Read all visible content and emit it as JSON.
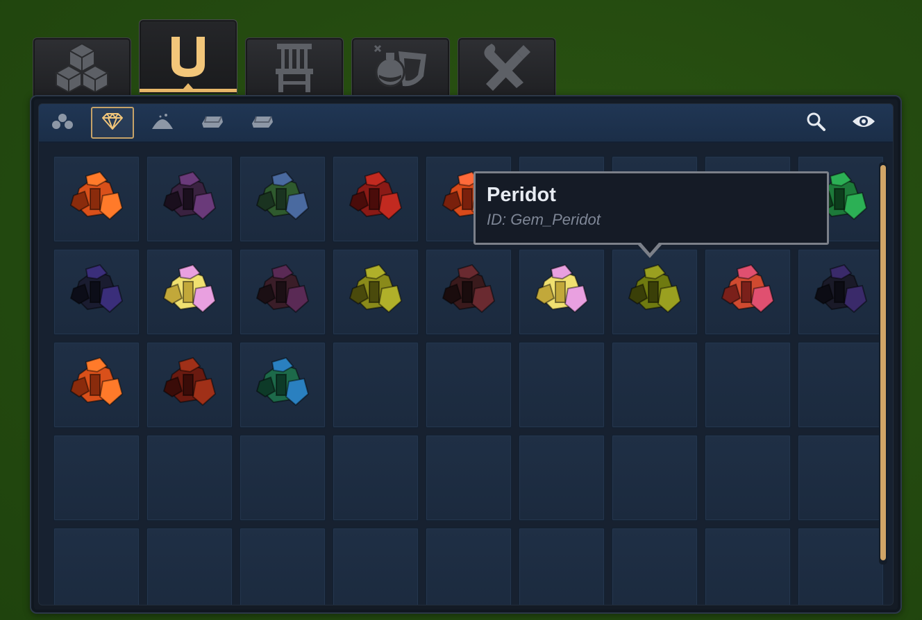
{
  "tabs": [
    {
      "name": "blocks-icon",
      "active": false
    },
    {
      "name": "u-magnet-icon",
      "active": true
    },
    {
      "name": "chair-icon",
      "active": false
    },
    {
      "name": "potion-shield-icon",
      "active": false
    },
    {
      "name": "wrench-pencil-icon",
      "active": false
    }
  ],
  "subtabs": [
    {
      "name": "ores-icon",
      "active": false
    },
    {
      "name": "gem-icon",
      "active": true
    },
    {
      "name": "dust-pile-icon",
      "active": false
    },
    {
      "name": "ingot-icon",
      "active": false
    },
    {
      "name": "ingot-bar-icon",
      "active": false
    }
  ],
  "toolbar": {
    "search_icon": "search-icon",
    "visibility_icon": "eye-icon"
  },
  "colors": {
    "accent": "#e9b96a",
    "panel": "#172130",
    "header": "#1f3452",
    "slot": "#1e2d42"
  },
  "gems": [
    {
      "c1": "#d9501a",
      "c2": "#ff7a2a",
      "c3": "#8a2b0c"
    },
    {
      "c1": "#3a2240",
      "c2": "#6a3a7a",
      "c3": "#1a0f1d"
    },
    {
      "c1": "#2f5a2e",
      "c2": "#4a6aa0",
      "c3": "#1a3320"
    },
    {
      "c1": "#8a1a16",
      "c2": "#c22a20",
      "c3": "#4a0c0a"
    },
    {
      "c1": "#d84a1a",
      "c2": "#ff6a3a",
      "c3": "#7a200c"
    },
    null,
    null,
    null,
    {
      "c1": "#1d7a3a",
      "c2": "#2cb055",
      "c3": "#0d3d1c"
    },
    {
      "c1": "#1a1c30",
      "c2": "#3a2e7a",
      "c3": "#0c0d18"
    },
    {
      "c1": "#f0e070",
      "c2": "#e9a0e0",
      "c3": "#c2a83a"
    },
    {
      "c1": "#3a1d28",
      "c2": "#5a2a55",
      "c3": "#1b0f14"
    },
    {
      "c1": "#8a8a1a",
      "c2": "#b0b02a",
      "c3": "#4a4a0c"
    },
    {
      "c1": "#3a1a1c",
      "c2": "#6a2a30",
      "c3": "#1a0c0d"
    },
    {
      "c1": "#f0e070",
      "c2": "#e9a0e0",
      "c3": "#c2a83a"
    },
    {
      "c1": "#6f7a10",
      "c2": "#9aa020",
      "c3": "#3a3f08"
    },
    {
      "c1": "#d04a30",
      "c2": "#e05070",
      "c3": "#7a201a"
    },
    {
      "c1": "#1a1a28",
      "c2": "#3a2a6a",
      "c3": "#0c0c14"
    },
    {
      "c1": "#d9501a",
      "c2": "#ff7a2a",
      "c3": "#8a2b0c"
    },
    {
      "c1": "#6a1a10",
      "c2": "#a03018",
      "c3": "#3a0c08"
    },
    {
      "c1": "#1d6a4a",
      "c2": "#2a80c0",
      "c3": "#0d3a28"
    },
    null,
    null,
    null,
    null,
    null,
    null,
    null,
    null,
    null,
    null,
    null,
    null,
    null,
    null,
    null,
    null,
    null,
    null,
    null,
    null,
    null,
    null,
    null,
    null
  ],
  "tooltip": {
    "title": "Peridot",
    "id_line": "ID: Gem_Peridot"
  }
}
